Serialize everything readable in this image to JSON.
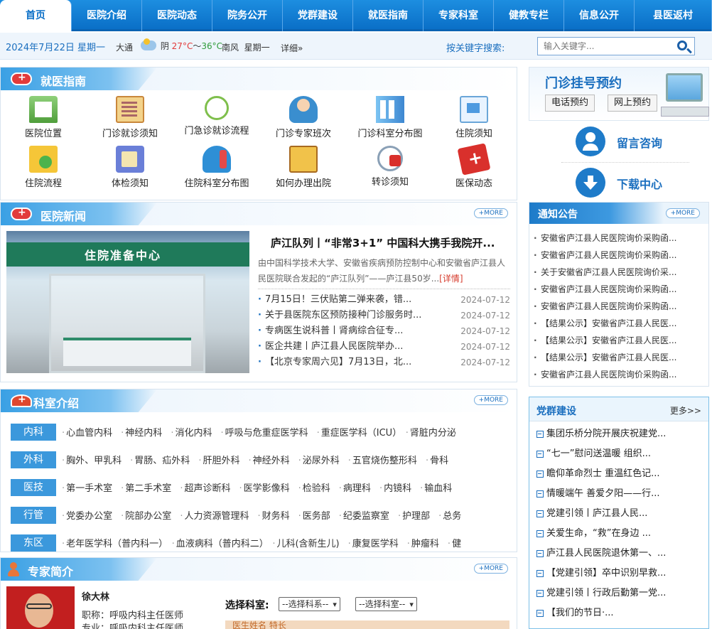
{
  "nav": [
    {
      "label": "首页",
      "active": true
    },
    {
      "label": "医院介绍"
    },
    {
      "label": "医院动态"
    },
    {
      "label": "院务公开"
    },
    {
      "label": "党群建设"
    },
    {
      "label": "就医指南"
    },
    {
      "label": "专家科室"
    },
    {
      "label": "健教专栏"
    },
    {
      "label": "信息公开"
    },
    {
      "label": "县医返村"
    }
  ],
  "subbar": {
    "date": "2024年7月22日 星期一",
    "city": "大通",
    "weather_text": "阴",
    "temp_high": "27°C",
    "temp_sep": "～",
    "temp_low": "36°C",
    "wind": "南风",
    "weekday": "星期一",
    "more": "详细»",
    "kw_label": "按关键字搜索:",
    "search_placeholder": "输入关键字..."
  },
  "guide": {
    "title": "就医指南",
    "items": [
      {
        "label": "医院位置",
        "icon": "hospital-icon"
      },
      {
        "label": "门诊就诊须知",
        "icon": "clipboard-icon"
      },
      {
        "label": "门急诊就诊流程",
        "icon": "stethoscope-icon"
      },
      {
        "label": "门诊专家班次",
        "icon": "nurse-icon"
      },
      {
        "label": "门诊科室分布图",
        "icon": "building-icon"
      },
      {
        "label": "住院须知",
        "icon": "card-icon"
      },
      {
        "label": "住院流程",
        "icon": "folder-icon"
      },
      {
        "label": "体检须知",
        "icon": "cards-icon"
      },
      {
        "label": "住院科室分布图",
        "icon": "iv-drip-icon"
      },
      {
        "label": "如何办理出院",
        "icon": "notebook-icon"
      },
      {
        "label": "转诊须知",
        "icon": "blood-pressure-icon"
      },
      {
        "label": "医保动态",
        "icon": "medical-kit-icon"
      }
    ]
  },
  "news": {
    "title": "医院新闻",
    "more": "+MORE",
    "image_banner": "住院准备中心",
    "headline": "庐江队列丨“非常3+1” 中国科大携手我院开...",
    "summary": "由中国科学技术大学、安徽省疾病预防控制中心和安徽省庐江县人民医院联合发起的“庐江队列”——庐江县50岁...",
    "detail": "[详情]",
    "list": [
      {
        "title": "7月15日！三伏贴第二弹来袭，错...",
        "date": "2024-07-12"
      },
      {
        "title": "关于县医院东区预防接种门诊服务时...",
        "date": "2024-07-12"
      },
      {
        "title": "专病医生说科普丨肾病综合征专...",
        "date": "2024-07-12"
      },
      {
        "title": "医企共建丨庐江县人民医院举办...",
        "date": "2024-07-12"
      },
      {
        "title": "【北京专家周六见】7月13日，北...",
        "date": "2024-07-12"
      }
    ]
  },
  "depts": {
    "title": "科室介绍",
    "more": "+MORE",
    "rows": [
      {
        "tag": "内科",
        "items": [
          "心血管内科",
          "神经内科",
          "消化内科",
          "呼吸与危重症医学科",
          "重症医学科（ICU）",
          "肾脏内分泌"
        ]
      },
      {
        "tag": "外科",
        "items": [
          "胸外、甲乳科",
          "胃肠、疝外科",
          "肝胆外科",
          "神经外科",
          "泌尿外科",
          "五官烧伤整形科",
          "骨科"
        ]
      },
      {
        "tag": "医技",
        "items": [
          "第一手术室",
          "第二手术室",
          "超声诊断科",
          "医学影像科",
          "检验科",
          "病理科",
          "内镜科",
          "输血科"
        ]
      },
      {
        "tag": "行管",
        "items": [
          "党委办公室",
          "院部办公室",
          "人力资源管理科",
          "财务科",
          "医务部",
          "纪委监察室",
          "护理部",
          "总务"
        ]
      },
      {
        "tag": "东区",
        "items": [
          "老年医学科（普内科一）",
          "血液病科（普内科二）",
          "儿科(含新生儿)",
          "康复医学科",
          "肿瘤科",
          "健"
        ]
      }
    ]
  },
  "expert": {
    "title": "专家简介",
    "more": "+MORE",
    "name": "徐大林",
    "title_line": "职称：呼吸内科主任医师",
    "spec_line": "专业：呼吸内科主任医师...",
    "select_label": "选择科室:",
    "select1": "--选择科系--",
    "select2": "--选择科室--",
    "strip_text": "医生姓名 特长"
  },
  "side": {
    "appt_title": "门诊挂号预约",
    "phone_btn": "电话预约",
    "online_btn": "网上预约",
    "consult": "留言咨询",
    "download": "下载中心"
  },
  "notice": {
    "title": "通知公告",
    "more": "+MORE",
    "items": [
      "安徽省庐江县人民医院询价采购函...",
      "安徽省庐江县人民医院询价采购函...",
      "关于安徽省庐江县人民医院询价采...",
      "安徽省庐江县人民医院询价采购函...",
      "安徽省庐江县人民医院询价采购函...",
      "【结果公示】安徽省庐江县人民医...",
      "【结果公示】安徽省庐江县人民医...",
      "【结果公示】安徽省庐江县人民医...",
      "安徽省庐江县人民医院询价采购函..."
    ]
  },
  "party": {
    "title": "党群建设",
    "more": "更多>>",
    "items": [
      "集团乐桥分院开展庆祝建党...",
      "“七一”慰问送温暖 组织...",
      "瞻仰革命烈士 重温红色记...",
      "情暖端午 善爱夕阳——行...",
      "党建引领丨庐江县人民...",
      "关爱生命，“救”在身边 ...",
      "庐江县人民医院退休第一、...",
      "【党建引领】卒中识别早救...",
      "党建引领丨行政后勤第一党...",
      "【我们的节日·..."
    ]
  },
  "colors": {
    "nav": "#0a6fc7",
    "accent": "#1b6fbf",
    "tag": "#3b98dc",
    "temp_high": "#e23b3b",
    "temp_low": "#2e9b3a"
  }
}
